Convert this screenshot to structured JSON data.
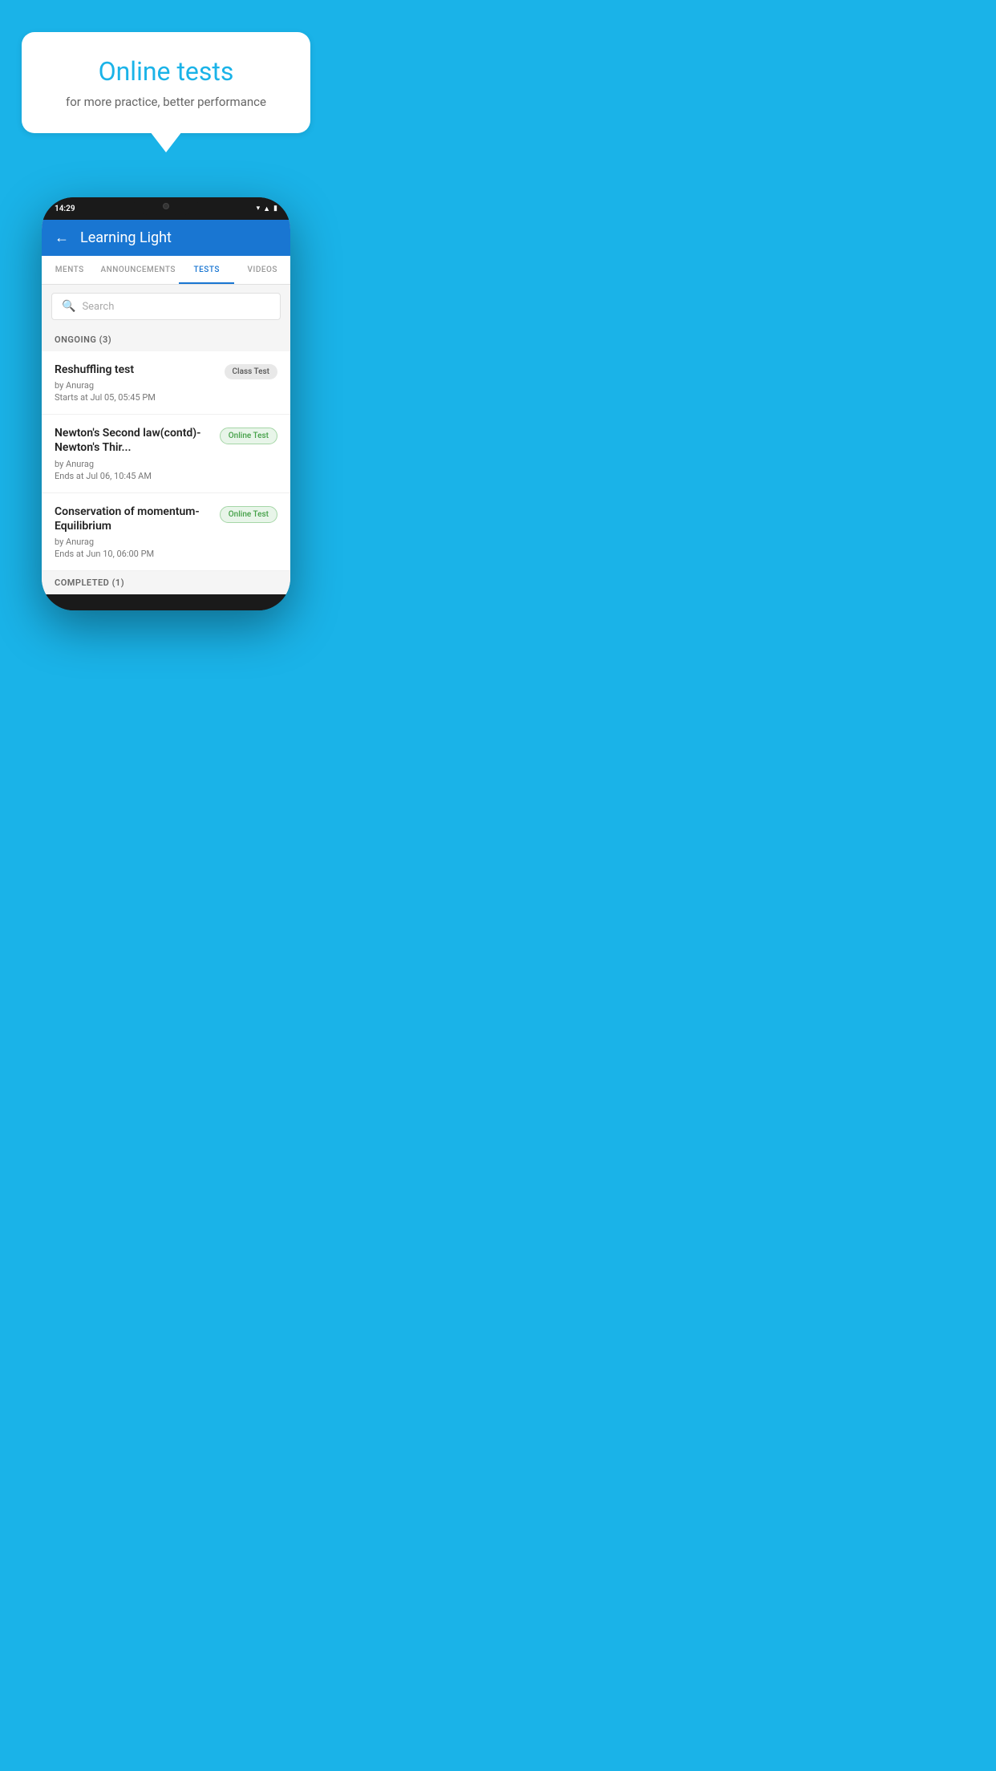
{
  "background_color": "#1ab3e8",
  "promo": {
    "bubble_title": "Online tests",
    "bubble_subtitle": "for more practice, better performance"
  },
  "phone": {
    "status_bar": {
      "time": "14:29",
      "icons": [
        "wifi",
        "signal",
        "battery"
      ]
    },
    "header": {
      "back_label": "←",
      "title": "Learning Light"
    },
    "tabs": [
      {
        "label": "MENTS",
        "active": false
      },
      {
        "label": "ANNOUNCEMENTS",
        "active": false
      },
      {
        "label": "TESTS",
        "active": true
      },
      {
        "label": "VIDEOS",
        "active": false
      }
    ],
    "search": {
      "placeholder": "Search"
    },
    "ongoing_section": {
      "label": "ONGOING (3)"
    },
    "tests": [
      {
        "name": "Reshuffling test",
        "author": "by Anurag",
        "date_label": "Starts at",
        "date": "Jul 05, 05:45 PM",
        "badge": "Class Test",
        "badge_type": "class"
      },
      {
        "name": "Newton's Second law(contd)-Newton's Thir...",
        "author": "by Anurag",
        "date_label": "Ends at",
        "date": "Jul 06, 10:45 AM",
        "badge": "Online Test",
        "badge_type": "online"
      },
      {
        "name": "Conservation of momentum-Equilibrium",
        "author": "by Anurag",
        "date_label": "Ends at",
        "date": "Jun 10, 06:00 PM",
        "badge": "Online Test",
        "badge_type": "online"
      }
    ],
    "completed_section": {
      "label": "COMPLETED (1)"
    }
  }
}
